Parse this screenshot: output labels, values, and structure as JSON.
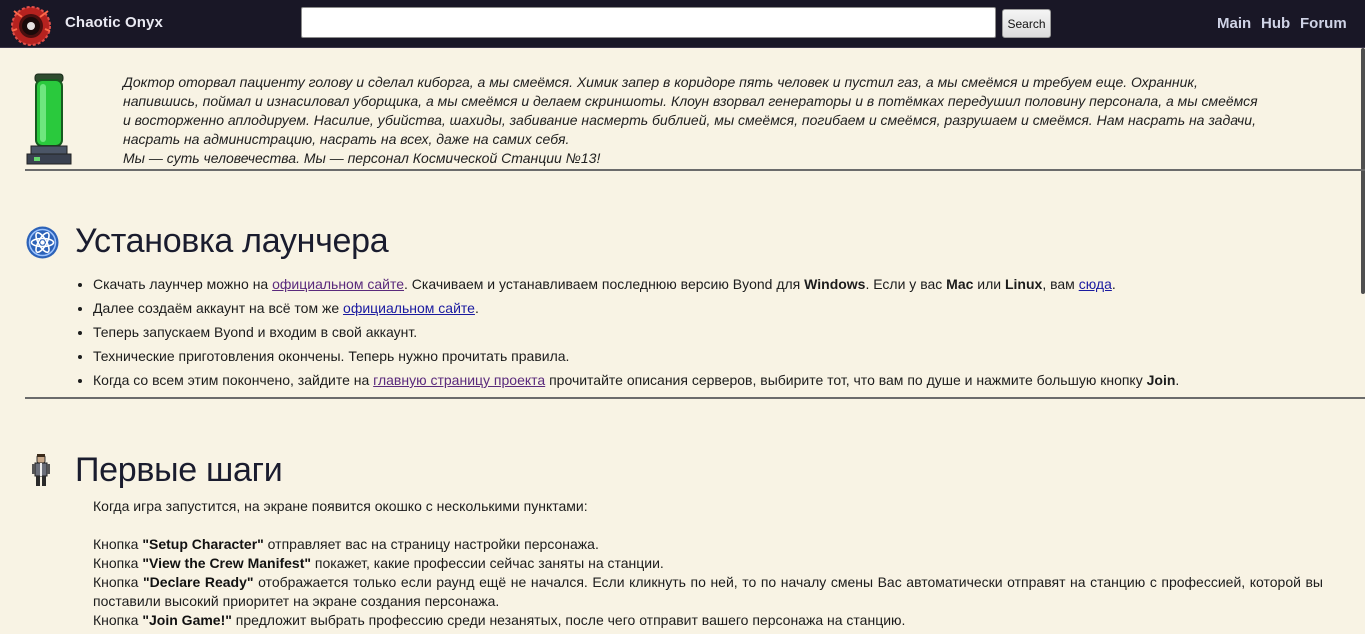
{
  "header": {
    "brand": "Chaotic Onyx",
    "search_placeholder": "",
    "search_button": "Search",
    "nav": [
      "Main",
      "Hub",
      "Forum"
    ]
  },
  "quote": {
    "body": "Доктор оторвал пациенту голову и сделал киборга, а мы смеёмся. Химик запер в коридоре пять человек и пустил газ, а мы смеёмся и требуем еще. Охранник, напившись, поймал и изнасиловал уборщика, а мы смеёмся и делаем скриншоты. Клоун взорвал генераторы и в потёмках передушил половину персонала, а мы смеёмся и восторженно аплодируем. Насилие, убийства, шахиды, забивание насмерть библией, мы смеёмся, погибаем и смеёмся, разрушаем и смеёмся. Нам насрать на задачи, насрать на администрацию, насрать на всех, даже на самих себя.",
    "last": "Мы — суть человечества. Мы — персонал Космической Станции №13!"
  },
  "install": {
    "title": "Установка лаунчера",
    "items": [
      {
        "t1": "Скачать лаунчер можно на ",
        "link": "официальном сайте",
        "t2": ". Скачиваем и устанавливаем последнюю версию Byond для ",
        "b1": "Windows",
        "t3": ". Если у вас ",
        "b2": "Mac",
        "t4": " или ",
        "b3": "Linux",
        "t5": ", вам ",
        "link2": "сюда",
        "t6": "."
      },
      {
        "t1": "Далее создаём аккаунт на всё том же ",
        "link": "официальном сайте",
        "t2": "."
      },
      {
        "t1": "Теперь запускаем Byond и входим в свой аккаунт."
      },
      {
        "t1": "Технические приготовления окончены. Теперь нужно прочитать правила."
      },
      {
        "t1": "Когда со всем этим покончено, зайдите на ",
        "link": "главную страницу проекта",
        "t2": " прочитайте описания серверов, выбирите тот, что вам по душе и нажмите большую кнопку ",
        "b1": "Join",
        "t3": "."
      }
    ]
  },
  "first": {
    "title": "Первые шаги",
    "intro": "Когда игра запустится, на экране появится окошко с несколькими пунктами:",
    "lines": [
      {
        "pre": "Кнопка ",
        "b": "\"Setup Character\"",
        "post": " отправляет вас на страницу настройки персонажа."
      },
      {
        "pre": "Кнопка ",
        "b": "\"View the Crew Manifest\"",
        "post": " покажет, какие профессии сейчас заняты на станции."
      },
      {
        "pre": "Кнопка ",
        "b": "\"Declare Ready\"",
        "post": " отображается только если раунд ещё не начался. Если кликнуть по ней, то по началу смены Вас автоматически отправят на станцию с профессией, которой вы поставили высокий приоритет на экране создания персонажа."
      },
      {
        "pre": "Кнопка ",
        "b": "\"Join Game!\"",
        "post": " предложит выбрать профессию среди незанятых, после чего отправит вашего персонажа на станцию."
      }
    ]
  }
}
